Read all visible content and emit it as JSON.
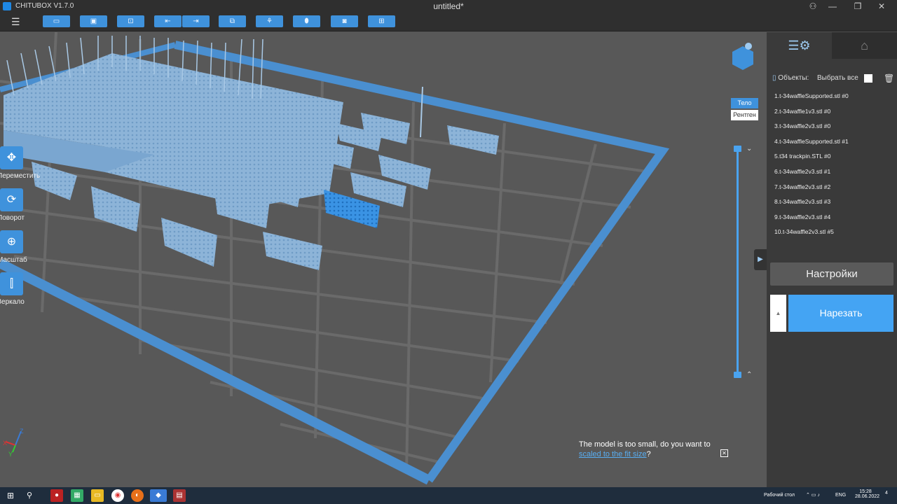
{
  "title_bar": {
    "app_name": "CHITUBOX V1.7.0",
    "document": "untitled*"
  },
  "toolbar": {
    "buttons": [
      "open-folder-icon",
      "save-icon",
      "import-icon",
      "arrange-icon",
      "export-icon",
      "copy-icon",
      "support-icon",
      "hollow-icon",
      "drill-icon",
      "package-icon"
    ]
  },
  "left_tools": [
    {
      "label": "Переместить",
      "icon": "move-icon"
    },
    {
      "label": "Поворот",
      "icon": "rotate-icon"
    },
    {
      "label": "Масштаб",
      "icon": "scale-icon"
    },
    {
      "label": "Зеркало",
      "icon": "mirror-icon"
    }
  ],
  "view_modes": {
    "body": "Тело",
    "xray": "Рентген"
  },
  "right_panel": {
    "objects_label": "Объекты:",
    "select_all_label": "Выбрать все",
    "objects": [
      "1.t-34waffleSupported.stl #0",
      "2.t-34waffle1v3.stl #0",
      "3.t-34waffle2v3.stl #0",
      "4.t-34waffleSupported.stl #1",
      "5.t34 trackpin.STL #0",
      "6.t-34waffle2v3.stl #1",
      "7.t-34waffle2v3.stl #2",
      "8.t-34waffle2v3.stl #3",
      "9.t-34waffle2v3.stl #4",
      "10.t-34waffle2v3.stl #5"
    ],
    "settings_label": "Настройки",
    "slice_label": "Нарезать"
  },
  "notification": {
    "text_before": "The model is too small, do you want to",
    "link_text": "scaled to the fit size",
    "text_after": "?"
  },
  "taskbar": {
    "desktop_label": "Рабочий стол",
    "lang": "ENG",
    "time": "15:28",
    "date": "28.06.2022",
    "notification_count": "4"
  },
  "colors": {
    "accent": "#3f92dc",
    "plate_border": "#4a90cf",
    "model": "#8fb7dc",
    "selected_model": "#2f86d8"
  }
}
